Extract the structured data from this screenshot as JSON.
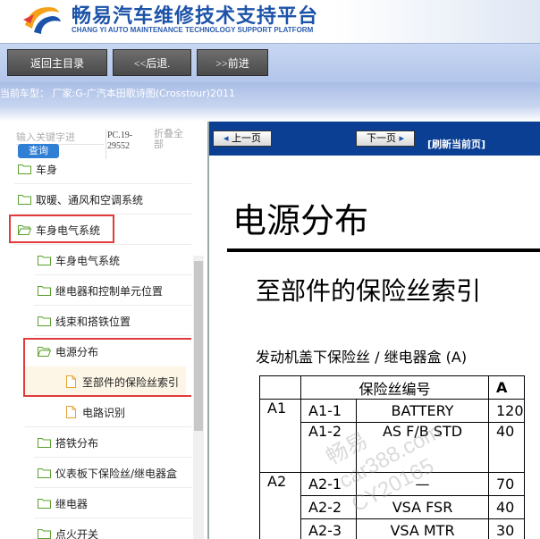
{
  "header": {
    "title": "畅易汽车维修技术支持平台",
    "subtitle": "CHANG YI AUTO MAINTENANCE TECHNOLOGY SUPPORT PLATFORM",
    "logo_icon": "cy-logo-icon",
    "brand_color": "#1c53a9",
    "accent_color": "#f5a21a"
  },
  "toolbar": {
    "home_label": "返回主目录",
    "back_label": "<<后退.",
    "forward_label": ">>前进"
  },
  "model": {
    "text": "当前车型： 厂家:G-广汽本田歌诗图(Crosstour)2011"
  },
  "search": {
    "placeholder": "输入关键字进",
    "button_label": "查询",
    "pc_code": "PC.19-29552",
    "collapse_all": "折叠全部"
  },
  "tree": [
    {
      "label": "车身",
      "icon": "folder-icon"
    },
    {
      "label": "取暖、通风和空调系统",
      "icon": "folder-icon"
    },
    {
      "label": "车身电气系统",
      "icon": "folder-open-icon"
    },
    {
      "label": "车身电气系统",
      "icon": "folder-icon"
    },
    {
      "label": "继电器和控制单元位置",
      "icon": "folder-icon"
    },
    {
      "label": "线束和搭铁位置",
      "icon": "folder-icon"
    },
    {
      "label": "电源分布",
      "icon": "folder-open-icon"
    },
    {
      "label": "至部件的保险丝索引",
      "icon": "document-icon"
    },
    {
      "label": "电路识别",
      "icon": "document-icon"
    },
    {
      "label": "搭铁分布",
      "icon": "folder-icon"
    },
    {
      "label": "仪表板下保险丝/继电器盒",
      "icon": "folder-icon"
    },
    {
      "label": "继电器",
      "icon": "folder-icon"
    },
    {
      "label": "点火开关",
      "icon": "folder-icon"
    }
  ],
  "doc_nav": {
    "prev_label": "上一页",
    "next_label": "下一页",
    "refresh_label": "[刷新当前页]"
  },
  "doc": {
    "title": "电源分布",
    "subtitle": "至部件的保险丝索引",
    "caption": "发动机盖下保险丝 / 继电器盒 (A)"
  },
  "fuse_table": {
    "header": "保险丝编号",
    "header_extra": "A",
    "rows": [
      {
        "group": "A1",
        "fuse": "A1-1",
        "name": "BATTERY",
        "amp": "120"
      },
      {
        "group": "",
        "fuse": "A1-2",
        "name": "AS F/B STD",
        "amp": "40"
      },
      {
        "group": "A2",
        "fuse": "A2-1",
        "name": "—",
        "amp": "70"
      },
      {
        "group": "",
        "fuse": "A2-2",
        "name": "VSA FSR",
        "amp": "40"
      },
      {
        "group": "",
        "fuse": "A2-3",
        "name": "VSA MTR",
        "amp": "30"
      }
    ]
  },
  "watermark": {
    "line1": "畅易",
    "line2": "car388.com",
    "line3": "CY20165"
  }
}
